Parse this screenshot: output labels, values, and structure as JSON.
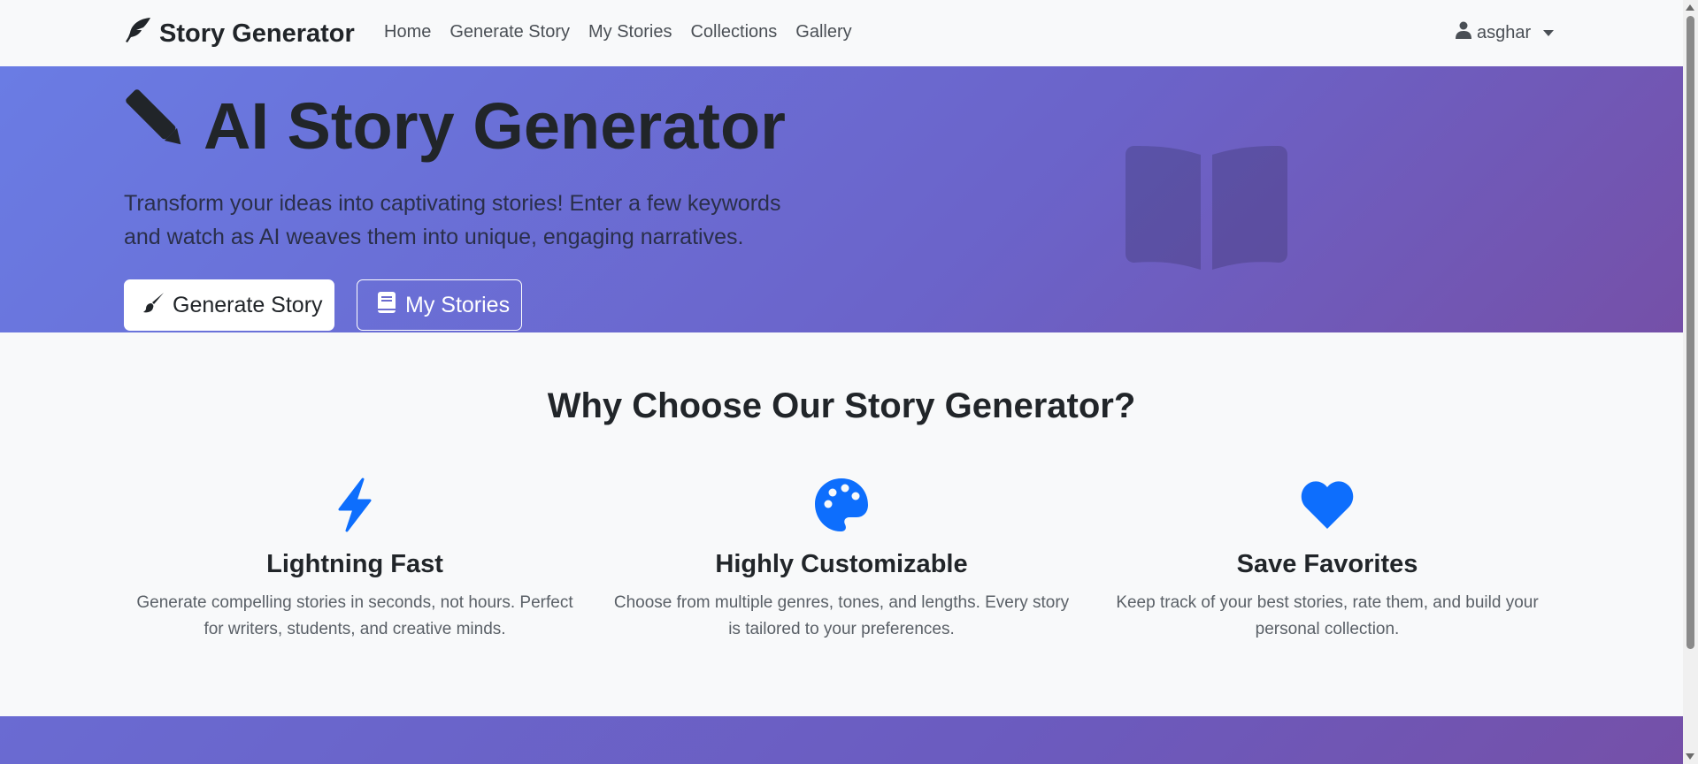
{
  "navbar": {
    "brand": "Story Generator",
    "brand_icon": "feather-icon",
    "links": [
      {
        "label": "Home"
      },
      {
        "label": "Generate Story"
      },
      {
        "label": "My Stories"
      },
      {
        "label": "Collections"
      },
      {
        "label": "Gallery"
      }
    ],
    "user": {
      "name": "asghar",
      "icon": "user-icon"
    }
  },
  "hero": {
    "title": "AI Story Generator",
    "title_icon": "pen-icon",
    "subtitle": "Transform your ideas into captivating stories! Enter a few keywords and watch as AI weaves them into unique, engaging narratives.",
    "primary_button": "Generate Story",
    "secondary_button": "My Stories",
    "illustration_icon": "open-book-icon"
  },
  "features": {
    "title": "Why Choose Our Story Generator?",
    "items": [
      {
        "icon": "lightning-icon",
        "title": "Lightning Fast",
        "text": "Generate compelling stories in seconds, not hours. Perfect for writers, students, and creative minds."
      },
      {
        "icon": "palette-icon",
        "title": "Highly Customizable",
        "text": "Choose from multiple genres, tones, and lengths. Every story is tailored to your preferences."
      },
      {
        "icon": "heart-icon",
        "title": "Save Favorites",
        "text": "Keep track of your best stories, rate them, and build your personal collection."
      }
    ]
  },
  "colors": {
    "accent": "#0d6efd",
    "hero_gradient_start": "#6a7ce4",
    "hero_gradient_end": "#7550a8",
    "background": "#f8f9fa"
  }
}
